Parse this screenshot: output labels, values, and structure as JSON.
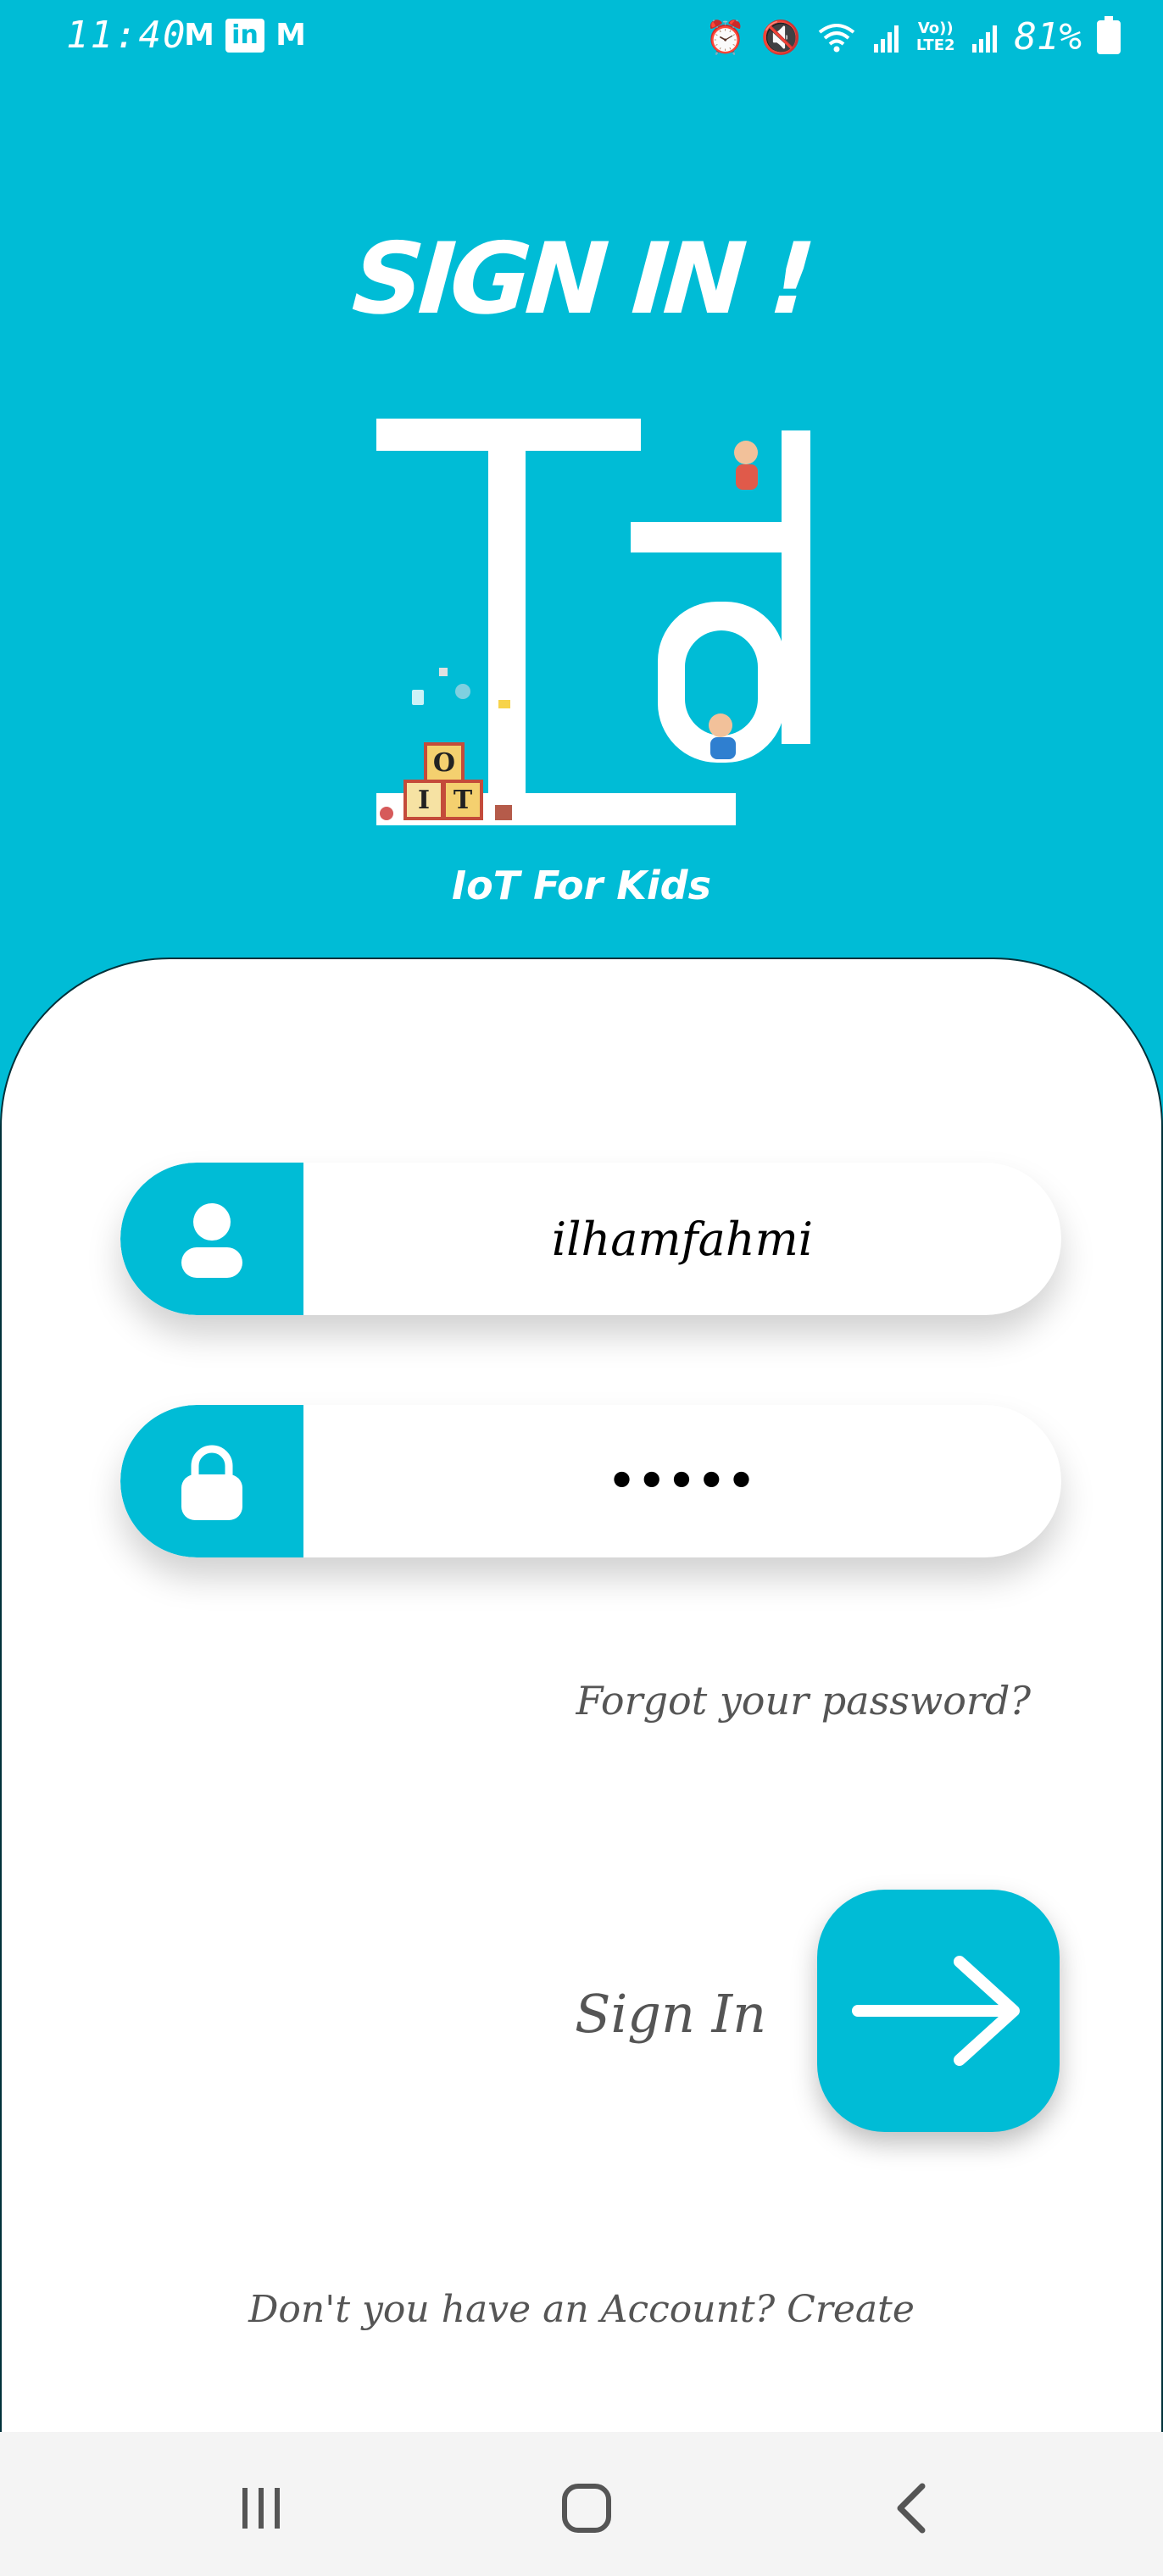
{
  "status_bar": {
    "time": "11:40",
    "notification_icons": [
      "gmail-icon",
      "linkedin-icon",
      "gmail-icon"
    ],
    "right_icons": [
      "alarm-icon",
      "mute-icon",
      "wifi-icon",
      "signal-icon",
      "volte-icon",
      "signal-icon"
    ],
    "volte_label": "VoLTE2",
    "battery_percent": "81%"
  },
  "header": {
    "title": "SIGN IN !",
    "logo_caption": "IoT For Kids",
    "logo_block_letters": [
      "O",
      "I",
      "T"
    ]
  },
  "form": {
    "username_value": "ilhamfahmi",
    "password_value": "•••••",
    "forgot_password": "Forgot your password?",
    "signin_label": "Sign In",
    "create_account": "Don't you have an Account? Create"
  },
  "colors": {
    "primary": "#00bcd6",
    "card": "#ffffff",
    "muted_text": "#555555"
  }
}
